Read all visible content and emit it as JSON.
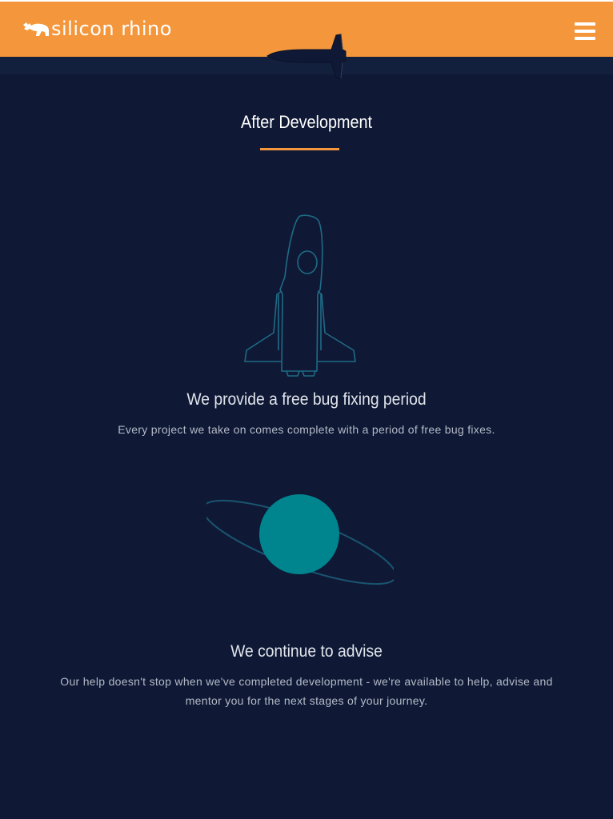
{
  "header": {
    "brand": "silicon rhino",
    "logo_icon": "rhino-icon",
    "menu_icon": "hamburger-menu-icon",
    "background_color": "#f4963c"
  },
  "section": {
    "title": "After Development",
    "accent_color": "#f4963c"
  },
  "features": [
    {
      "icon": "rocket-icon",
      "heading": "We provide a free bug fixing period",
      "text": "Every project we take on comes complete with a period of free bug fixes."
    },
    {
      "icon": "planet-icon",
      "heading": "We continue to advise",
      "text": "Our help doesn't stop when we've completed development - we're available to help, advise and mentor you for the next stages of your journey."
    }
  ],
  "colors": {
    "page_background": "#0f1935",
    "icon_outline": "#1f6a85",
    "planet_fill": "#00848e"
  }
}
